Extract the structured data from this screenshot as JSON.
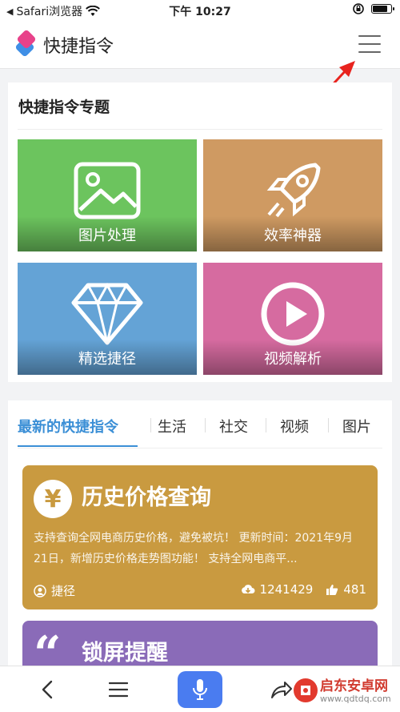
{
  "status_bar": {
    "carrier": "Safari浏览器",
    "time": "下午 10:27",
    "battery_level": 0.85
  },
  "header": {
    "title": "快捷指令"
  },
  "topics": {
    "title": "快捷指令专题",
    "tiles": [
      {
        "label": "图片处理",
        "icon": "image-icon",
        "color": "#6cc45e"
      },
      {
        "label": "效率神器",
        "icon": "rocket-icon",
        "color": "#cf9a62"
      },
      {
        "label": "精选捷径",
        "icon": "diamond-icon",
        "color": "#64a3d6"
      },
      {
        "label": "视频解析",
        "icon": "play-icon",
        "color": "#d66ba0"
      }
    ]
  },
  "latest": {
    "tabs": [
      "最新的快捷指令",
      "生活",
      "社交",
      "视频",
      "图片"
    ],
    "cards": [
      {
        "icon_symbol": "¥",
        "title": "历史价格查询",
        "description": "支持查询全网电商历史价格，避免被坑！ 更新时间：2021年9月21日，新增历史价格走势图功能！ 支持全网电商平...",
        "author": "捷径",
        "downloads": "1241429",
        "likes": "481",
        "color": "#c99a40"
      },
      {
        "icon_symbol": "“",
        "title": "锁屏提醒",
        "color": "#8a6bb8"
      }
    ]
  },
  "watermark": {
    "name": "启东安卓网",
    "url": "www.qdtdq.com"
  },
  "accent_color": "#3b8fd6"
}
